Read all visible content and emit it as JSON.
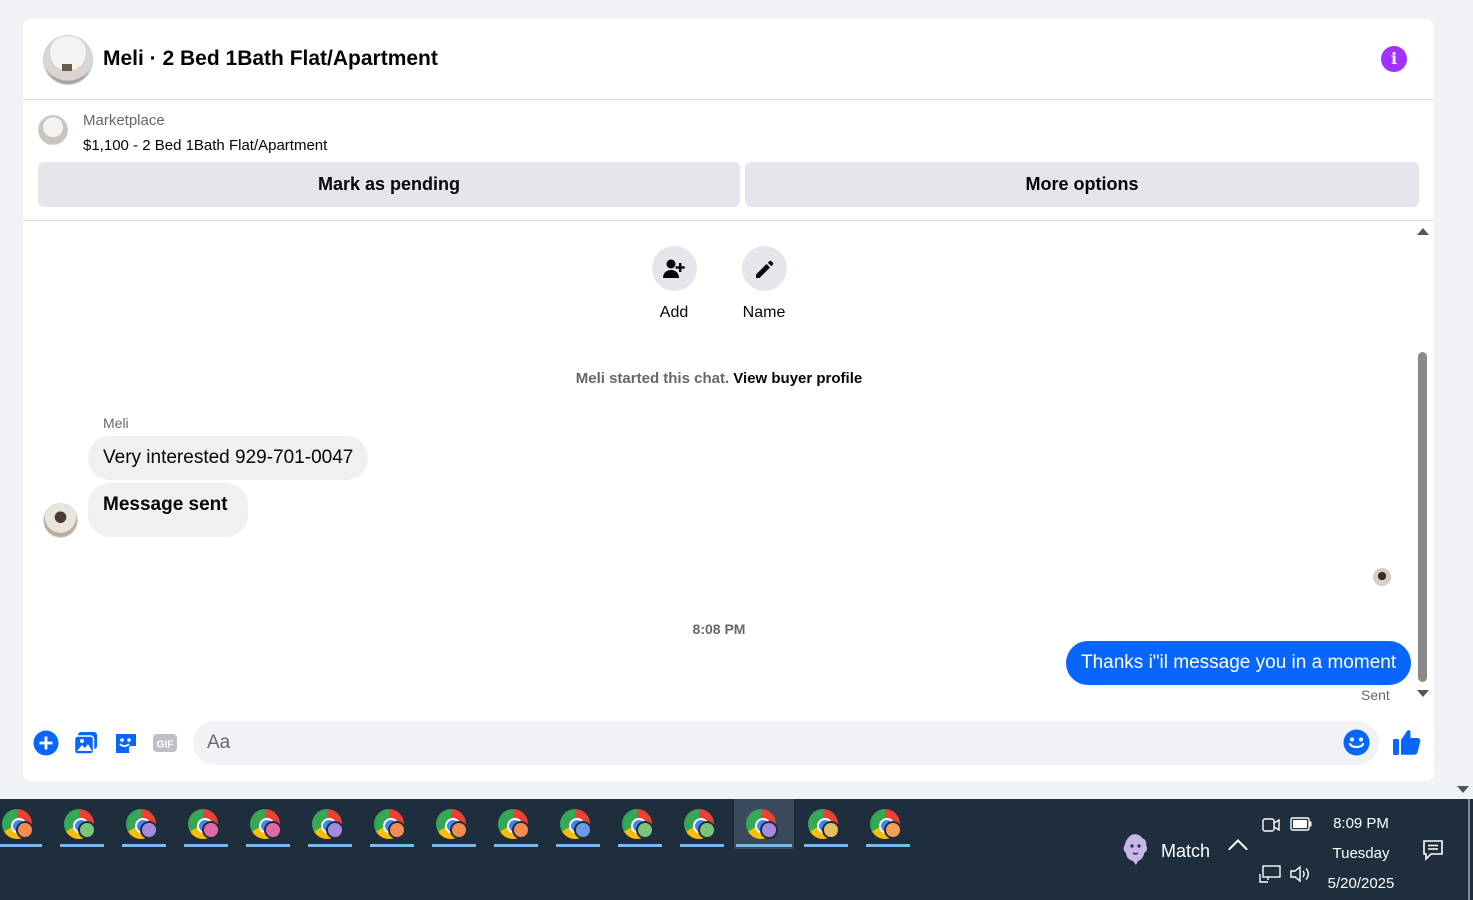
{
  "header": {
    "title": "Meli · 2 Bed 1Bath Flat/Apartment"
  },
  "listing": {
    "source": "Marketplace",
    "description": "$1,100 - 2 Bed 1Bath Flat/Apartment",
    "mark_pending_label": "Mark as pending",
    "more_options_label": "More options"
  },
  "actions": {
    "add_label": "Add",
    "name_label": "Name"
  },
  "chat": {
    "started_text": "Meli started this chat.",
    "view_profile_link": "View buyer profile",
    "sender_name": "Meli",
    "incoming": [
      "Very interested 929-701-0047",
      "Message sent"
    ],
    "timestamp": "8:08 PM",
    "outgoing": "Thanks i\"il message you in a moment",
    "sent_status": "Sent"
  },
  "composer": {
    "placeholder": "Aa"
  },
  "taskbar": {
    "match_label": "Match",
    "time": "8:09 PM",
    "day": "Tuesday",
    "date": "5/20/2025",
    "profile_colors": [
      "#f28b54",
      "#7cc47c",
      "#a58be0",
      "#e06aa8",
      "#e06aa8",
      "#a58be0",
      "#f28b54",
      "#f28b54",
      "#f28b54",
      "#6b9be0",
      "#7cc47c",
      "#7cc47c",
      "#a58be0",
      "#e0c060",
      "#f2a054"
    ]
  },
  "colors": {
    "accent_blue": "#0866ff",
    "info_purple": "#a033ff",
    "taskbar_bg": "#1f2e3d"
  }
}
